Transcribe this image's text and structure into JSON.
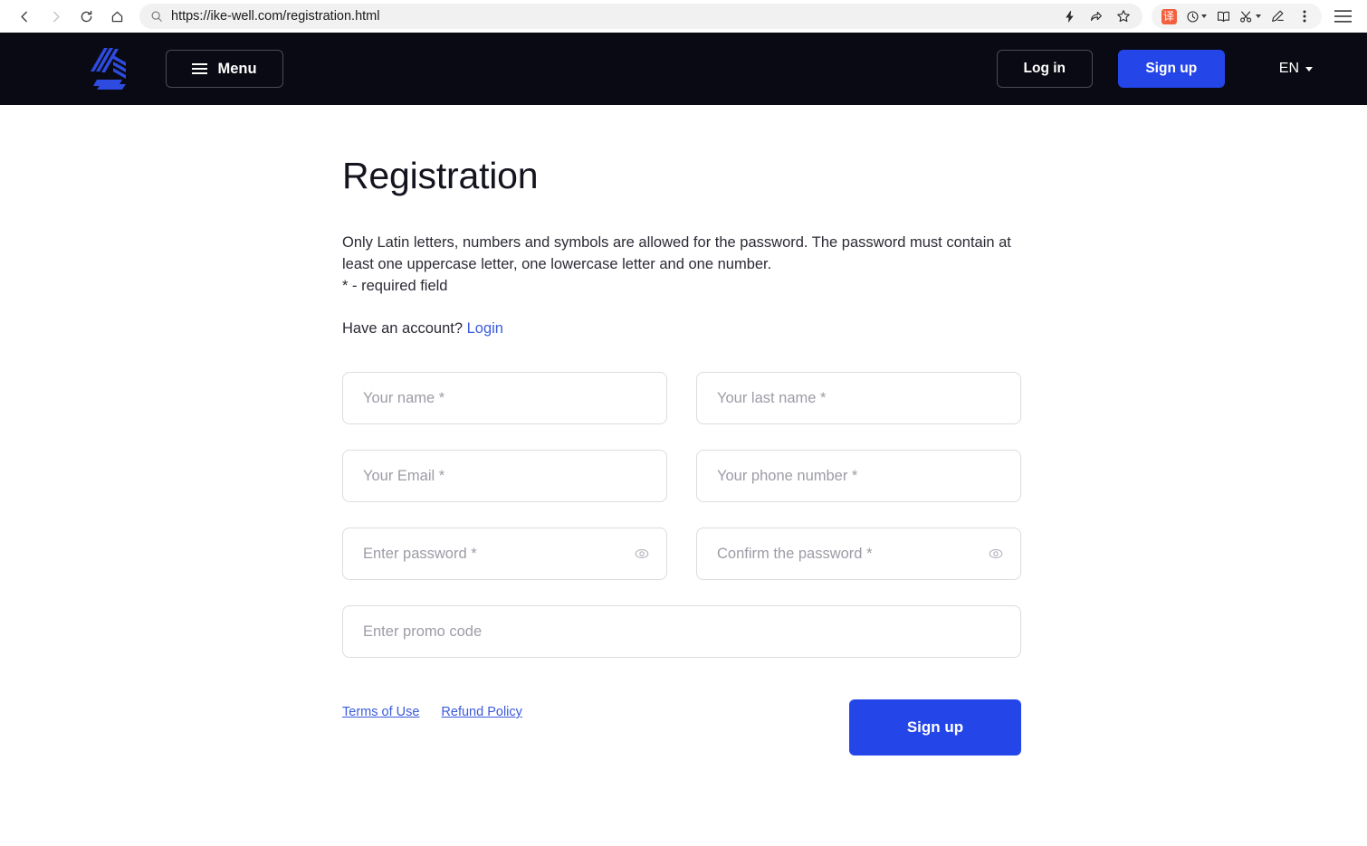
{
  "browser": {
    "url": "https://ike-well.com/registration.html",
    "nav": {
      "back": "back-arrow",
      "forward": "forward-arrow",
      "reload": "reload-icon",
      "home": "home-icon"
    },
    "url_icons": {
      "search": "search-icon",
      "lightning": "lightning-bolt-icon",
      "share": "share-icon",
      "bookmark": "bookmark-star-icon"
    },
    "extensions": [
      {
        "name": "translate-icon",
        "label": "译"
      },
      {
        "name": "history-icon",
        "label": ""
      },
      {
        "name": "reading-mode-icon",
        "label": ""
      },
      {
        "name": "screenshot-scissors-icon",
        "label": ""
      },
      {
        "name": "annotate-pen-icon",
        "label": ""
      },
      {
        "name": "more-options-icon",
        "label": ""
      }
    ],
    "app_menu": "hamburger-menu-icon"
  },
  "header": {
    "logo_alt": "ike-well-logo",
    "menu_label": "Menu",
    "login_label": "Log in",
    "signup_label": "Sign up",
    "language": "EN",
    "background": "#0a0a14",
    "accent": "#2446e8"
  },
  "main": {
    "title": "Registration",
    "description": "Only Latin letters, numbers and symbols are allowed for the password. The password must contain at least one uppercase letter, one lowercase letter and one number.",
    "required_note": "* - required field",
    "have_account_text": "Have an account?",
    "login_link": "Login",
    "fields": [
      {
        "name": "first-name",
        "placeholder": "Your name *",
        "value": "",
        "has_eye": false
      },
      {
        "name": "last-name",
        "placeholder": "Your last name *",
        "value": "",
        "has_eye": false
      },
      {
        "name": "email",
        "placeholder": "Your Email *",
        "value": "",
        "has_eye": false
      },
      {
        "name": "phone",
        "placeholder": "Your phone number *",
        "value": "",
        "has_eye": false
      },
      {
        "name": "password",
        "placeholder": "Enter password *",
        "value": "",
        "has_eye": true
      },
      {
        "name": "confirm-password",
        "placeholder": "Confirm the password *",
        "value": "",
        "has_eye": true
      },
      {
        "name": "promo-code",
        "placeholder": "Enter promo code",
        "value": "",
        "has_eye": false
      }
    ],
    "terms_link": "Terms of Use",
    "refund_link": "Refund Policy",
    "submit_label": "Sign up"
  }
}
